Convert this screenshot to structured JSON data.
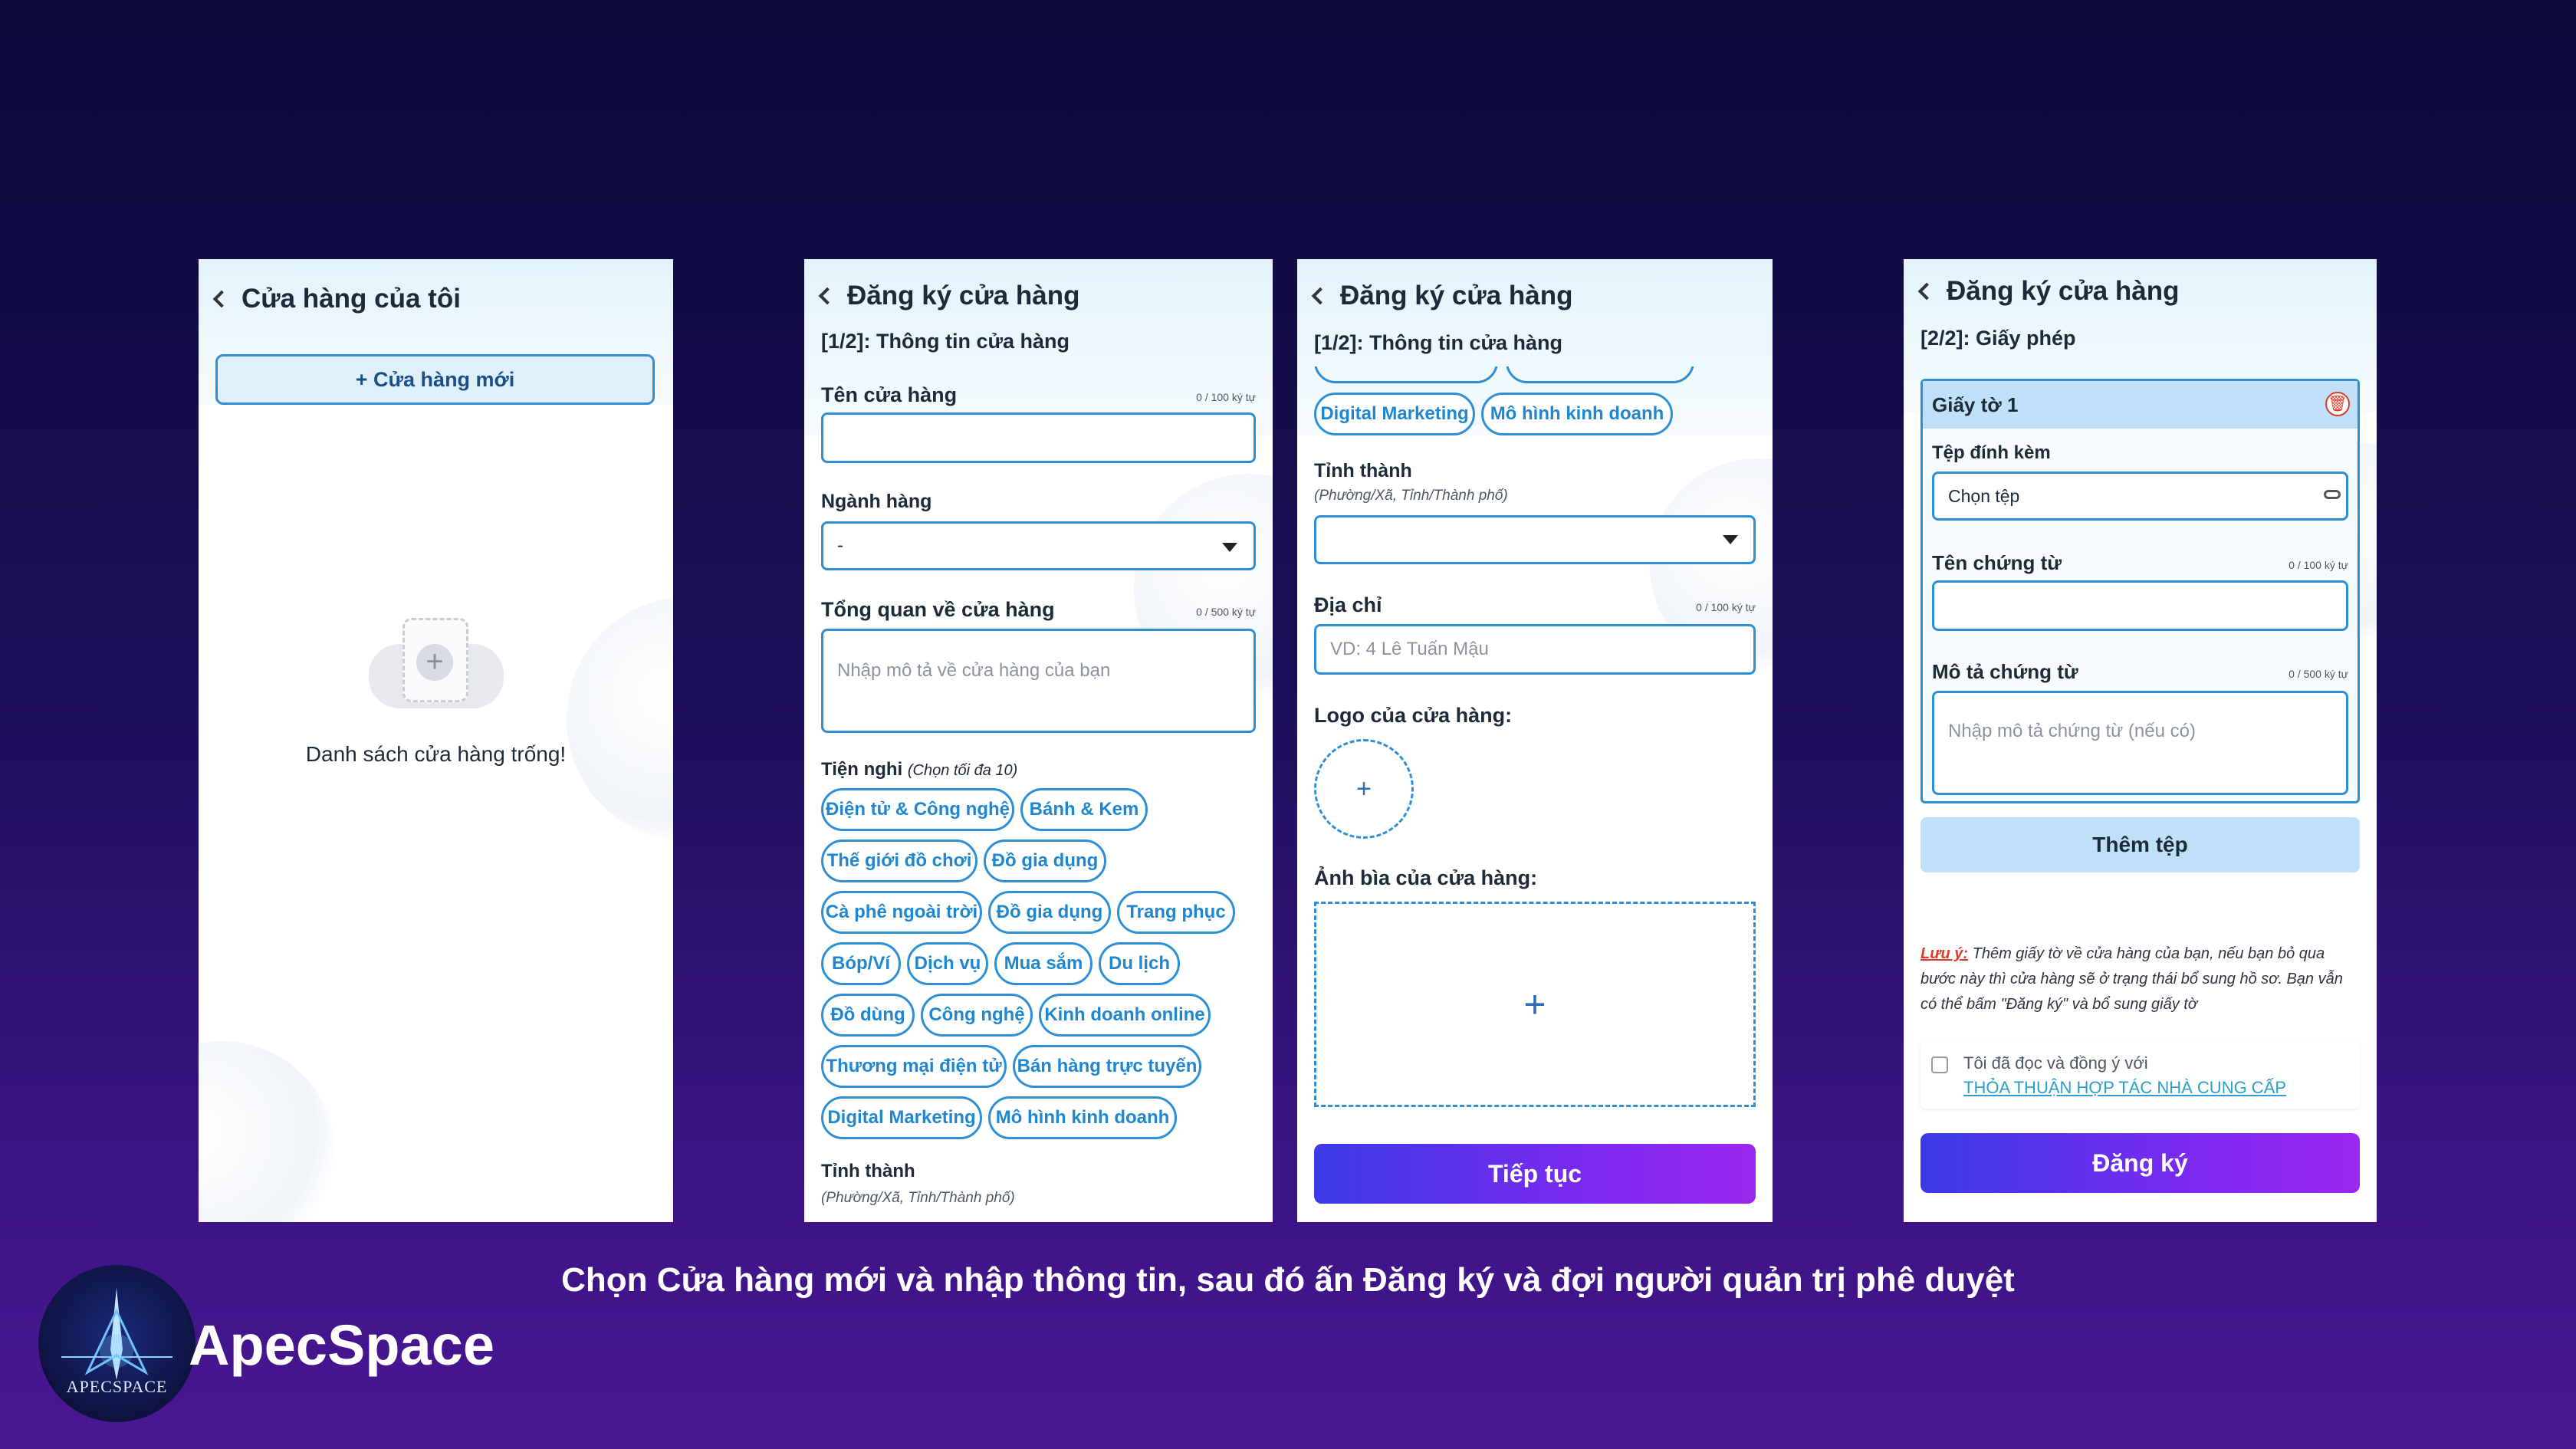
{
  "screen1": {
    "title": "Cửa hàng của tôi",
    "new_store_button": "+ Cửa hàng mới",
    "empty_text": "Danh sách cửa hàng trống!"
  },
  "screen2": {
    "title": "Đăng ký cửa hàng",
    "step": "[1/2]: Thông tin cửa hàng",
    "store_name_label": "Tên cửa hàng",
    "store_name_counter": "0 / 100 ký tự",
    "industry_label": "Ngành hàng",
    "industry_value": "-",
    "overview_label": "Tổng quan về cửa hàng",
    "overview_counter": "0 / 500 ký tự",
    "overview_placeholder": "Nhập mô tả về cửa hàng của bạn",
    "amenities_label": "Tiện nghi",
    "amenities_hint": "(Chọn tối đa 10)",
    "chips": [
      "Điện tử & Công nghệ",
      "Bánh & Kem",
      "Thế giới đồ chơi",
      "Đồ gia dụng",
      "Cà phê ngoài trời",
      "Đồ gia dụng",
      "Trang phục",
      "Bóp/Ví",
      "Dịch vụ",
      "Mua sắm",
      "Du lịch",
      "Đồ dùng",
      "Công nghệ",
      "Kinh doanh online",
      "Thương mại điện tử",
      "Bán hàng trực tuyến",
      "Digital Marketing",
      "Mô hình kinh doanh"
    ],
    "province_label": "Tỉnh thành",
    "province_hint": "(Phường/Xã, Tỉnh/Thành phố)"
  },
  "screen3": {
    "title": "Đăng ký cửa hàng",
    "step": "[1/2]: Thông tin cửa hàng",
    "chips": [
      "Digital Marketing",
      "Mô hình kinh doanh"
    ],
    "province_label": "Tỉnh thành",
    "province_hint": "(Phường/Xã, Tỉnh/Thành phố)",
    "address_label": "Địa chỉ",
    "address_counter": "0 / 100 ký tự",
    "address_placeholder": "VD: 4 Lê Tuấn Mậu",
    "logo_label": "Logo của cửa hàng:",
    "cover_label": "Ảnh bìa của cửa hàng:",
    "continue_button": "Tiếp tục"
  },
  "screen4": {
    "title": "Đăng ký cửa hàng",
    "step": "[2/2]: Giấy phép",
    "doc_header": "Giấy tờ 1",
    "attachment_label": "Tệp đính kèm",
    "attachment_value": "Chọn tệp",
    "doc_name_label": "Tên chứng từ",
    "doc_name_counter": "0 / 100 ký tự",
    "doc_desc_label": "Mô tả chứng từ",
    "doc_desc_counter": "0 / 500 ký tự",
    "doc_desc_placeholder": "Nhập mô tả chứng từ (nếu có)",
    "add_file_button": "Thêm tệp",
    "note_label": "Lưu ý:",
    "note_text": "Thêm giấy tờ về cửa hàng của bạn, nếu bạn bỏ qua bước này thì cửa hàng sẽ ở trạng thái bổ sung hồ sơ. Bạn vẫn có thể bấm \"Đăng ký\" và bổ sung giấy tờ",
    "agree_text": "Tôi đã đọc và đồng ý với",
    "agree_link": "THỎA THUẬN HỢP TÁC NHÀ CUNG CẤP",
    "register_button": "Đăng ký"
  },
  "caption": "Chọn Cửa hàng mới và nhập thông tin, sau đó ấn Đăng ký và đợi người quản trị phê duyệt",
  "brand": {
    "name": "ApecSpace",
    "logo_text": "APECSPACE"
  },
  "colors": {
    "accent_blue": "#2f8fd6",
    "button_gradient_start": "#3a3ae6",
    "button_gradient_end": "#9b28f0",
    "note_red": "#e0392b"
  }
}
